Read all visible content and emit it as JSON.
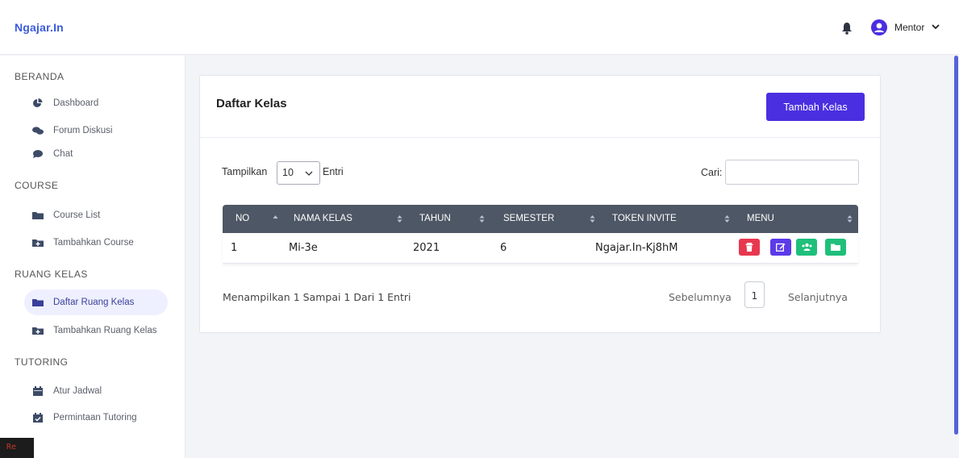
{
  "header": {
    "brand": "Ngajar.In",
    "user_name": "Mentor"
  },
  "sidebar": {
    "sections": [
      {
        "title": "BERANDA",
        "items": [
          {
            "label": "Dashboard",
            "icon": "chart-pie-icon"
          },
          {
            "label": "Forum Diskusi",
            "icon": "comments-icon"
          },
          {
            "label": "Chat",
            "icon": "chat-bubble-icon"
          }
        ]
      },
      {
        "title": "COURSE",
        "items": [
          {
            "label": "Course List",
            "icon": "folder-icon"
          },
          {
            "label": "Tambahkan Course",
            "icon": "folder-plus-icon"
          }
        ]
      },
      {
        "title": "RUANG KELAS",
        "items": [
          {
            "label": "Daftar Ruang Kelas",
            "icon": "folder-icon",
            "active": true
          },
          {
            "label": "Tambahkan Ruang Kelas",
            "icon": "folder-plus-icon"
          }
        ]
      },
      {
        "title": "TUTORING",
        "items": [
          {
            "label": "Atur Jadwal",
            "icon": "calendar-icon"
          },
          {
            "label": "Permintaan Tutoring",
            "icon": "calendar-check-icon"
          }
        ]
      }
    ]
  },
  "main": {
    "title": "Daftar Kelas",
    "add_button": "Tambah Kelas",
    "length_prefix": "Tampilkan",
    "length_value": "10",
    "length_suffix": "Entri",
    "search_label": "Cari:",
    "search_value": "",
    "table": {
      "columns": [
        "NO",
        "NAMA KELAS",
        "TAHUN",
        "SEMESTER",
        "TOKEN INVITE",
        "MENU"
      ],
      "rows": [
        {
          "no": "1",
          "nama_kelas": "Mi-3e",
          "tahun": "2021",
          "semester": "6",
          "token": "Ngajar.In-Kj8hM"
        }
      ]
    },
    "info": "Menampilkan 1 Sampai 1 Dari 1 Entri",
    "pagination": {
      "prev": "Sebelumnya",
      "current": "1",
      "next": "Selanjutnya"
    }
  },
  "colors": {
    "brand": "#3b5bdb",
    "primary_button": "#4a2fe0",
    "table_header": "#4e5765",
    "delete": "#e8384f",
    "edit": "#5b3be8",
    "members": "#1fbf7a",
    "open": "#1fbf7a"
  },
  "corner_badge": "Re"
}
